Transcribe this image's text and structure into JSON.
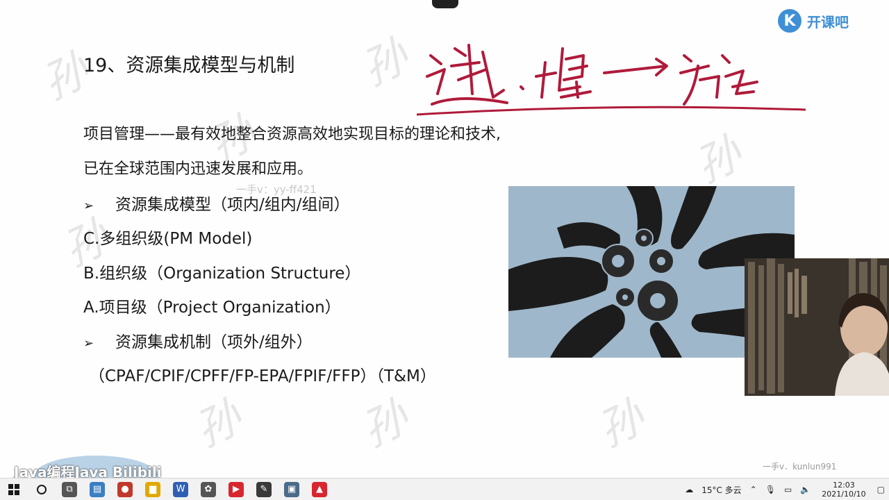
{
  "slide": {
    "title": "19、资源集成模型与机制",
    "intro_line1": "项目管理——最有效地整合资源高效地实现目标的理论和技术,",
    "intro_line2": "已在全球范围内迅速发展和应用。",
    "bullets": [
      {
        "marker": "➢",
        "text": "资源集成模型（项内/组内/组间）"
      },
      {
        "marker": "",
        "text": "C.多组织级(PM Model)"
      },
      {
        "marker": "",
        "text": "B.组织级（Organization Structure）"
      },
      {
        "marker": "",
        "text": "A.项目级（Project Organization）"
      },
      {
        "marker": "➢",
        "text": "资源集成机制（项外/组外）"
      },
      {
        "marker": "",
        "text": "（CPAF/CPIF/CPFF/FP-EPA/FPIF/FFP）（T&M）"
      }
    ],
    "overlay_contact": "一手v：yy-ff421",
    "webcam_watermark": "一手v．kunlun991",
    "channel_badge": "Java编程Java  Bilibili"
  },
  "logo": {
    "mark": "K",
    "text": "开课吧",
    "color": "#3f8fd6"
  },
  "taskbar": {
    "start_icon": "windows-icon",
    "search_icon": "search-icon",
    "apps": [
      {
        "name": "task-view-icon",
        "glyph": "⧉",
        "color": "#555555"
      },
      {
        "name": "file-explorer-icon",
        "glyph": "▤",
        "color": "#3b7fc4"
      },
      {
        "name": "media-player-icon",
        "glyph": "●",
        "color": "#c0392b"
      },
      {
        "name": "file-manager-icon",
        "glyph": "▆",
        "color": "#e0a800"
      },
      {
        "name": "wps-icon",
        "glyph": "W",
        "color": "#2f5fb3"
      },
      {
        "name": "video-icon",
        "glyph": "✿",
        "color": "#555555"
      },
      {
        "name": "record-icon",
        "glyph": "▶",
        "color": "#d8262f"
      },
      {
        "name": "notepad-icon",
        "glyph": "✎",
        "color": "#3a3a3a"
      },
      {
        "name": "screen-icon",
        "glyph": "▣",
        "color": "#4a6b8a"
      },
      {
        "name": "recorder-icon",
        "glyph": "▲",
        "color": "#d8262f"
      }
    ],
    "weather": "15°C 多云",
    "time": "12:03",
    "date": "2021/10/10"
  }
}
